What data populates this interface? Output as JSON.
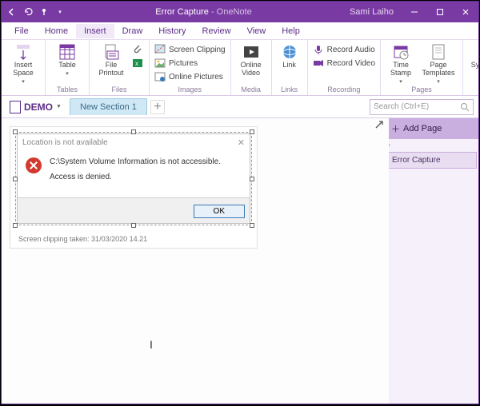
{
  "titlebar": {
    "document": "Error Capture",
    "separator": "  -  ",
    "app": "OneNote",
    "user": "Sami Laiho"
  },
  "menu": {
    "file": "File",
    "home": "Home",
    "insert": "Insert",
    "draw": "Draw",
    "history": "History",
    "review": "Review",
    "view": "View",
    "help": "Help"
  },
  "ribbon": {
    "insert_space": "Insert\nSpace",
    "table": "Table",
    "file_printout": "File\nPrintout",
    "screen_clipping": "Screen Clipping",
    "pictures": "Pictures",
    "online_pictures": "Online Pictures",
    "online_video": "Online\nVideo",
    "link": "Link",
    "record_audio": "Record Audio",
    "record_video": "Record Video",
    "time_stamp": "Time\nStamp",
    "page_templates": "Page\nTemplates",
    "symbols": "Symbols",
    "grp_tables": "Tables",
    "grp_files": "Files",
    "grp_images": "Images",
    "grp_media": "Media",
    "grp_links": "Links",
    "grp_recording": "Recording",
    "grp_pages": "Pages"
  },
  "tabs": {
    "notebook": "DEMO",
    "section": "New Section 1",
    "search_placeholder": "Search (Ctrl+E)"
  },
  "sidebar": {
    "add_page": "Add Page",
    "pages": [
      "Error Capture"
    ]
  },
  "clip": {
    "dlg_title": "Location is not available",
    "msg_line1": "C:\\System Volume Information is not accessible.",
    "msg_line2": "Access is denied.",
    "ok": "OK",
    "caption": "Screen clipping taken: 31/03/2020 14.21"
  },
  "colors": {
    "brand": "#7a3aa3",
    "accent": "#5b2d87"
  }
}
